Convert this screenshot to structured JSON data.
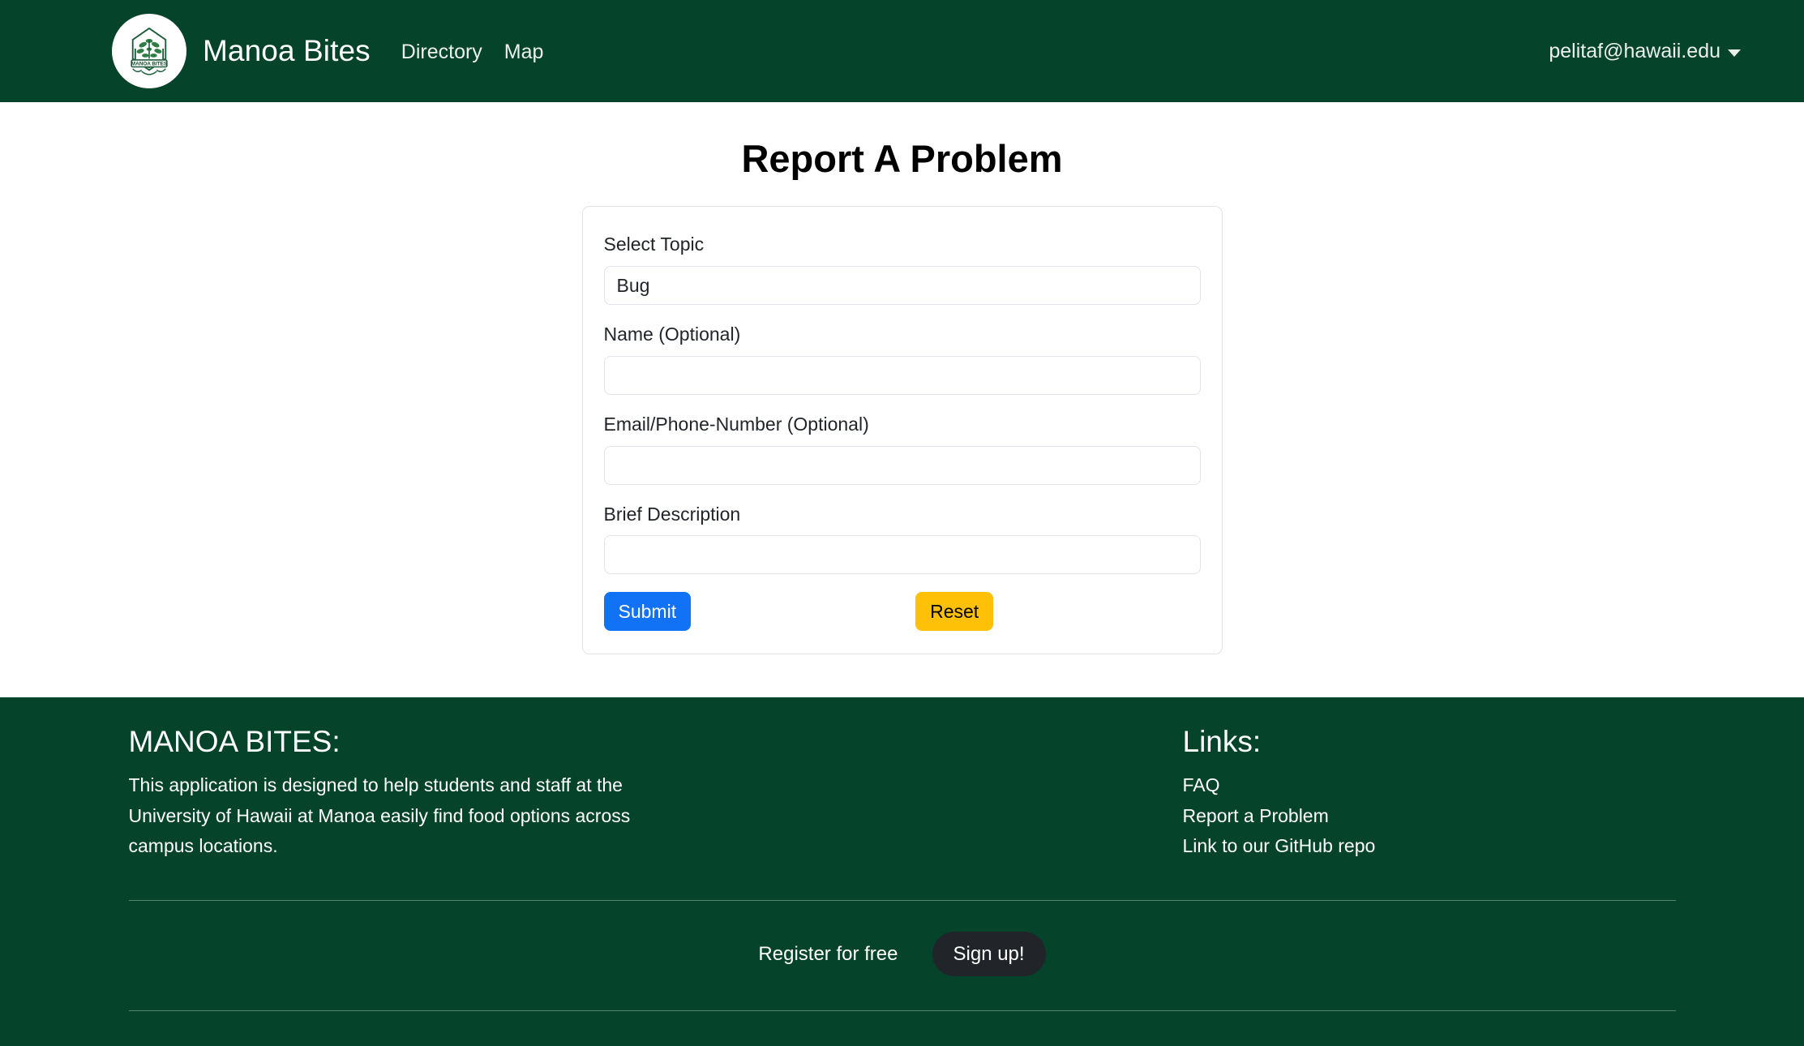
{
  "navbar": {
    "brand_name": "Manoa Bites",
    "logo_alt": "Manoa Bites crest logo",
    "logo_caption": "MANOA BITES",
    "links": [
      {
        "label": "Directory"
      },
      {
        "label": "Map"
      }
    ],
    "user_email": "pelitaf@hawaii.edu"
  },
  "main": {
    "page_title": "Report A Problem",
    "form": {
      "topic": {
        "label": "Select Topic",
        "value": "Bug",
        "options": [
          "Bug"
        ]
      },
      "name": {
        "label": "Name (Optional)",
        "value": "",
        "placeholder": ""
      },
      "contact": {
        "label": "Email/Phone-Number (Optional)",
        "value": "",
        "placeholder": ""
      },
      "description": {
        "label": "Brief Description",
        "value": "",
        "placeholder": ""
      },
      "submit_label": "Submit",
      "reset_label": "Reset"
    }
  },
  "footer": {
    "about_heading": "MANOA BITES:",
    "about_text": "This application is designed to help students and staff at the University of Hawaii at Manoa easily find food options across campus locations.",
    "links_heading": "Links:",
    "links": [
      {
        "label": "FAQ"
      },
      {
        "label": "Report a Problem"
      },
      {
        "label": "Link to our GitHub repo"
      }
    ],
    "register_text": "Register for free",
    "signup_label": "Sign up!"
  },
  "colors": {
    "brand_green": "#05432b",
    "submit_blue": "#1272f5",
    "reset_yellow": "#ffc107",
    "signup_dark": "#212529",
    "page_background": "#ffffff"
  }
}
